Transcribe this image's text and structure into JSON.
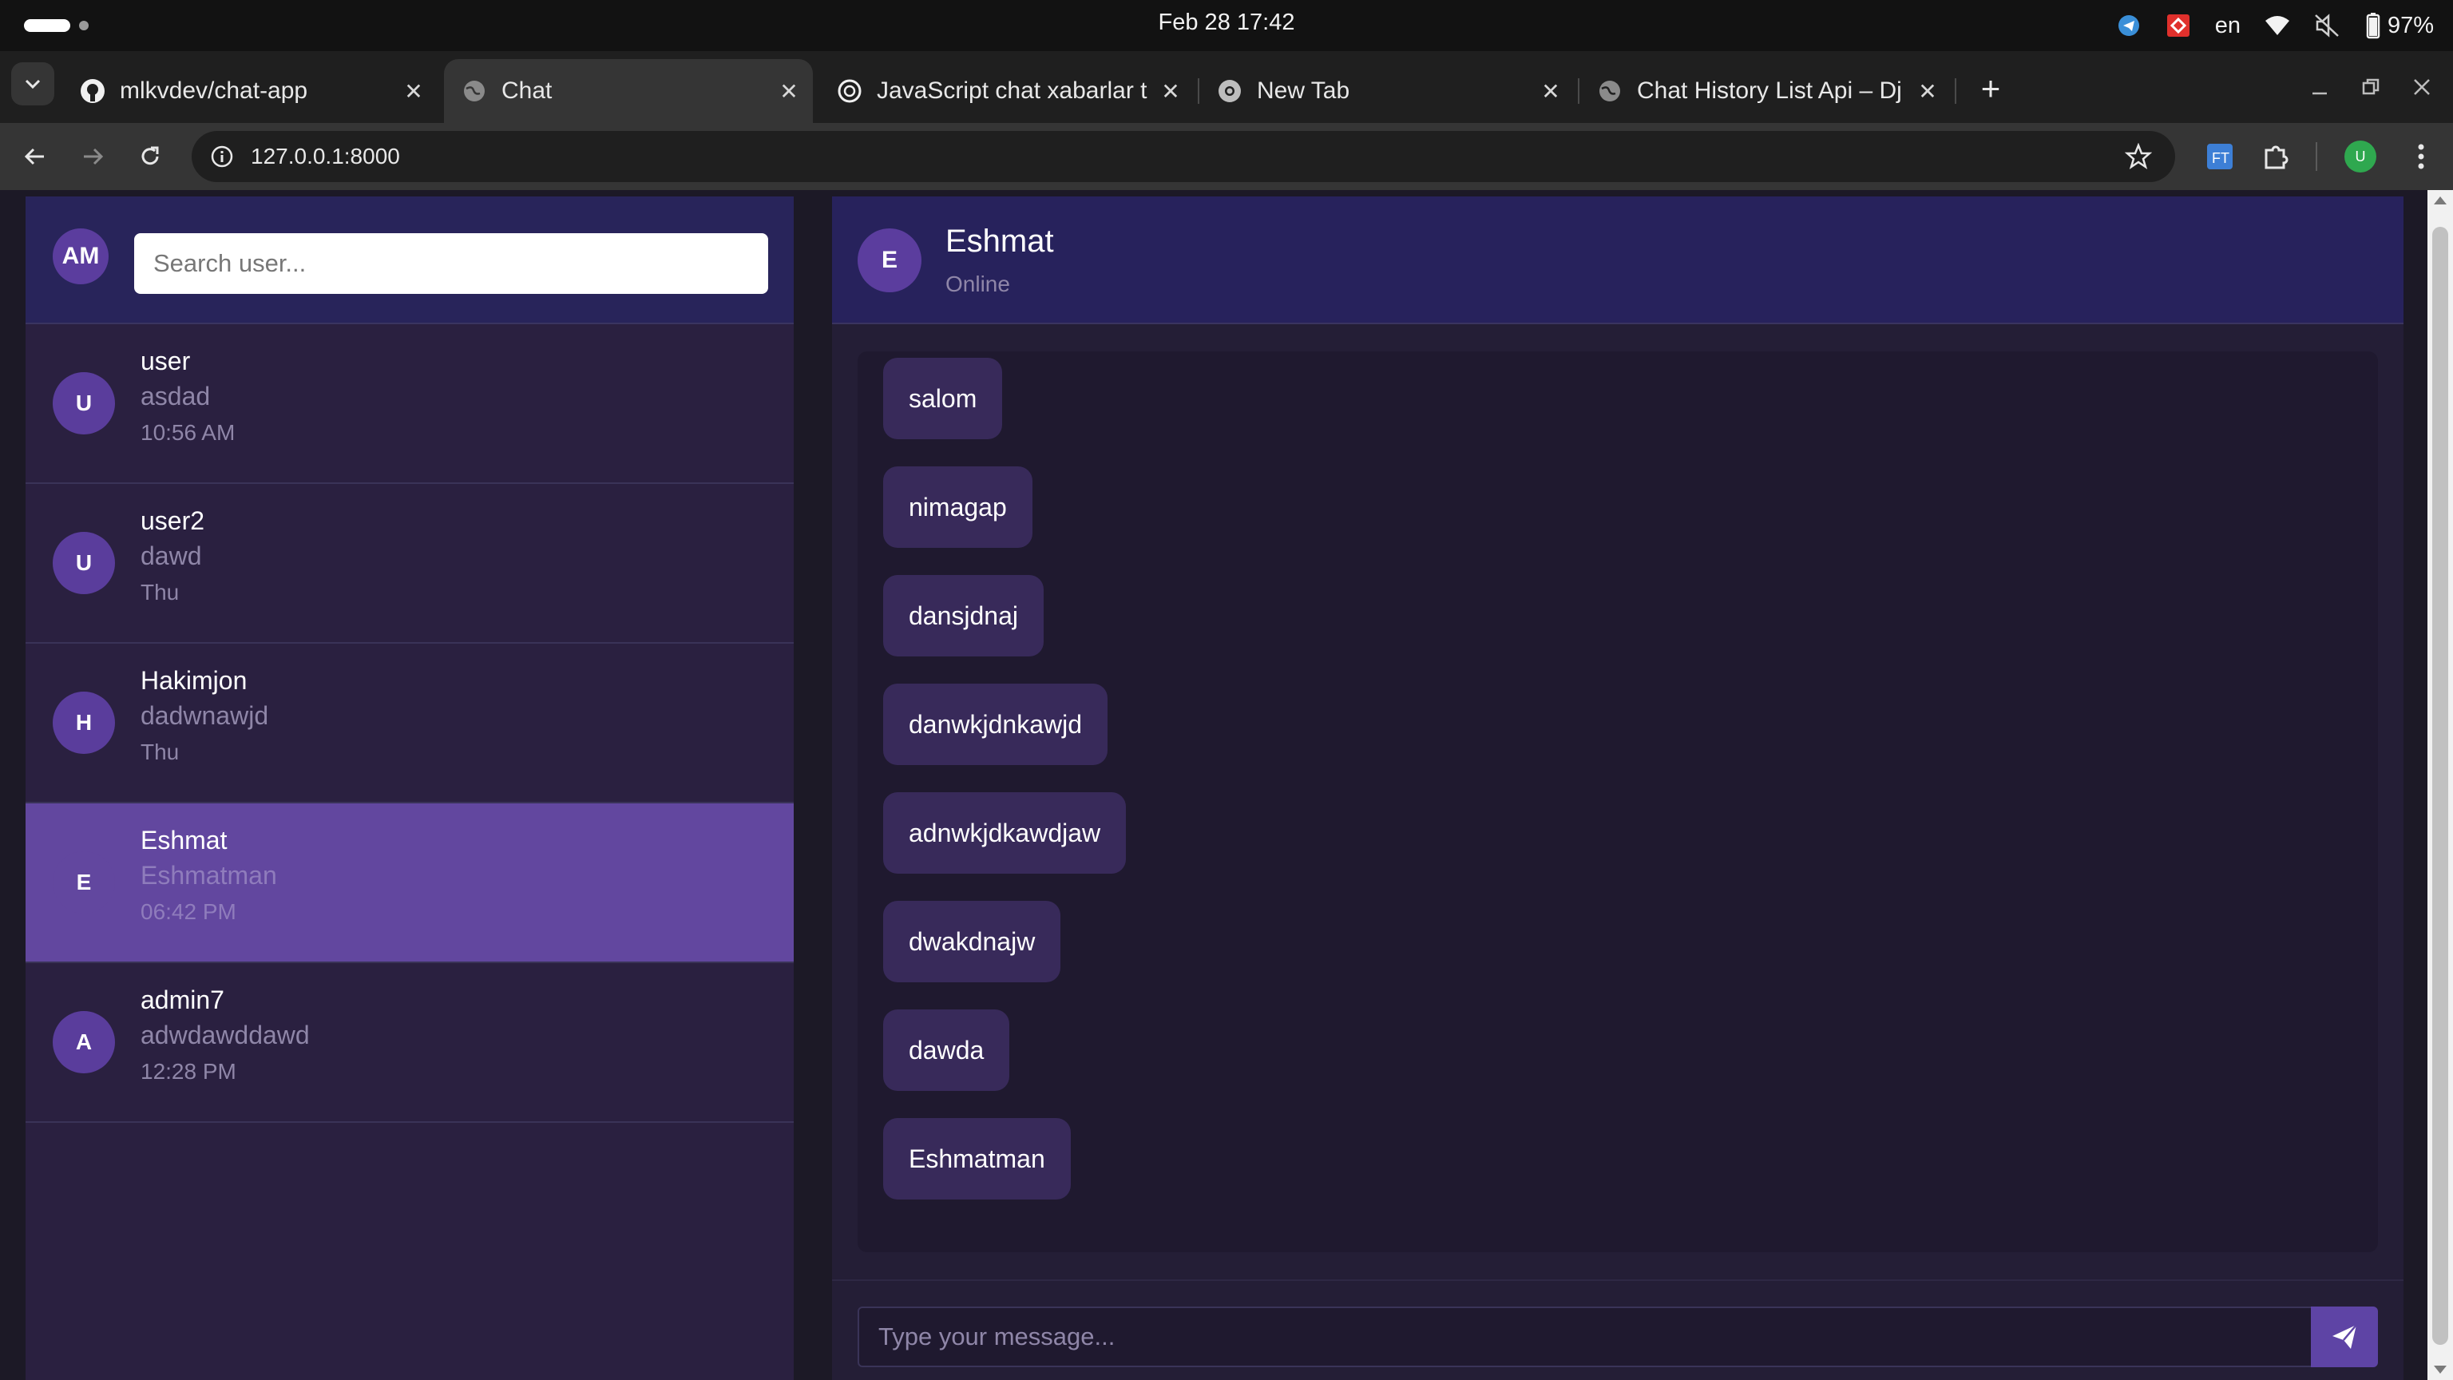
{
  "os": {
    "clock": "Feb 28  17:42",
    "language": "en",
    "battery": "97%"
  },
  "tabs": [
    {
      "title": "mlkvdev/chat-app",
      "favicon": "github-icon",
      "active": false
    },
    {
      "title": "Chat",
      "favicon": "globe-icon",
      "active": true
    },
    {
      "title": "JavaScript chat xabarlar t",
      "favicon": "openai-icon",
      "active": false
    },
    {
      "title": "New Tab",
      "favicon": "chrome-icon",
      "active": false
    },
    {
      "title": "Chat History List Api – Dj",
      "favicon": "globe-icon",
      "active": false
    }
  ],
  "toolbar": {
    "url": "127.0.0.1:8000",
    "profile_initial": "U"
  },
  "sidebar": {
    "me_initials": "AM",
    "search_placeholder": "Search user...",
    "contacts": [
      {
        "initial": "U",
        "name": "user",
        "last_message": "asdad",
        "time": "10:56 AM",
        "selected": false
      },
      {
        "initial": "U",
        "name": "user2",
        "last_message": "dawd",
        "time": "Thu",
        "selected": false
      },
      {
        "initial": "H",
        "name": "Hakimjon",
        "last_message": "dadwnawjd",
        "time": "Thu",
        "selected": false
      },
      {
        "initial": "E",
        "name": "Eshmat",
        "last_message": "Eshmatman",
        "time": "06:42 PM",
        "selected": true
      },
      {
        "initial": "A",
        "name": "admin7",
        "last_message": "adwdawddawd",
        "time": "12:28 PM",
        "selected": false
      }
    ]
  },
  "chat": {
    "contact_initial": "E",
    "contact_name": "Eshmat",
    "contact_status": "Online",
    "messages": [
      "salom",
      "nimagap",
      "dansjdnaj",
      "danwkjdnkawjd",
      "adnwkjdkawdjaw",
      "dwakdnajw",
      "dawda",
      "Eshmatman"
    ],
    "input_placeholder": "Type your message..."
  },
  "colors": {
    "sidebar_bg": "#2a2040",
    "header_bg": "#27225c",
    "selected_bg": "#62479f",
    "bubble_bg": "#382a5a",
    "send_button": "#5e44a5"
  }
}
